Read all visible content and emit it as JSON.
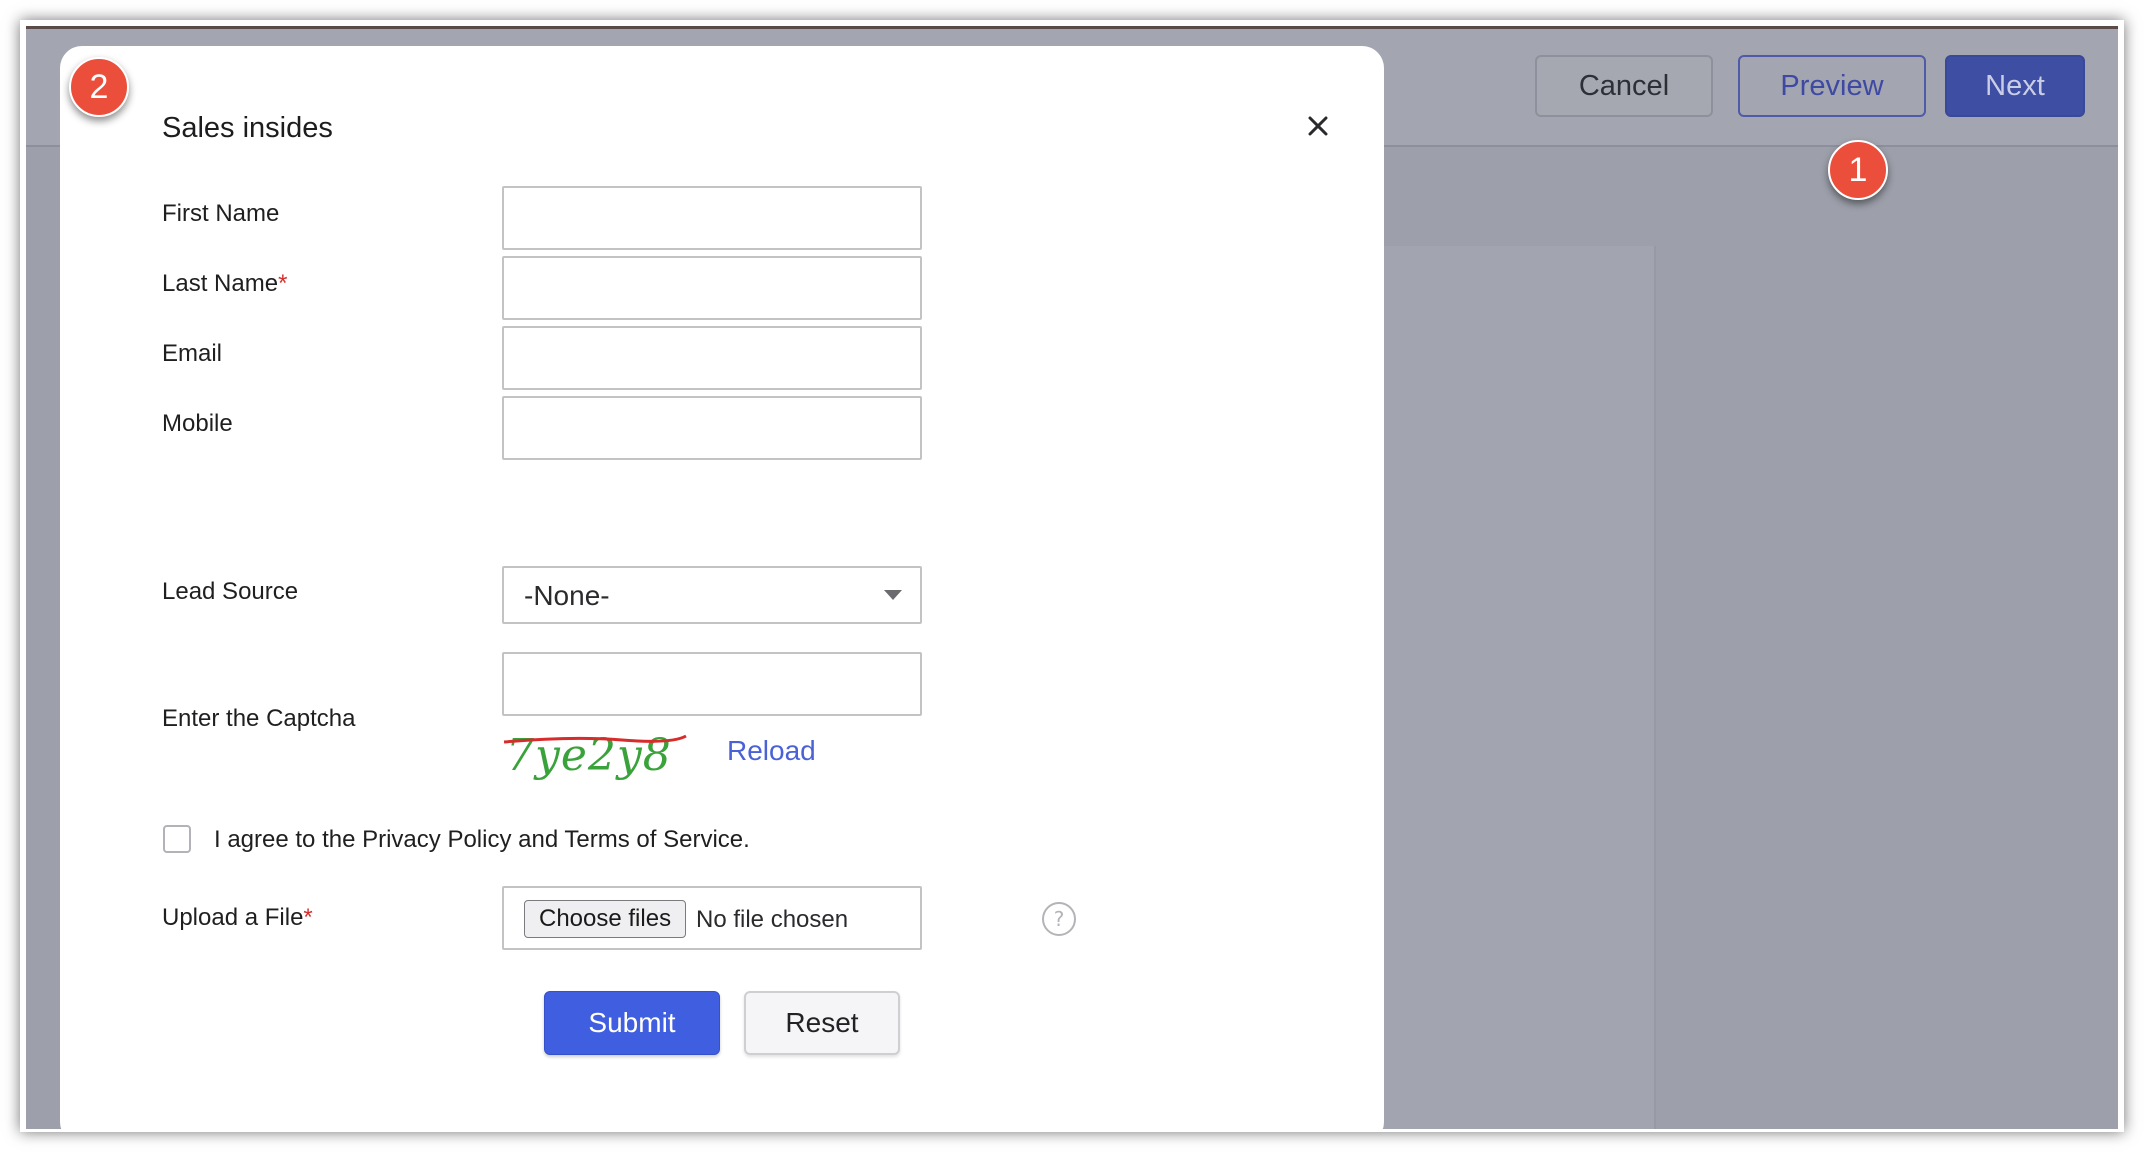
{
  "toolbar": {
    "cancel_label": "Cancel",
    "preview_label": "Preview",
    "next_label": "Next"
  },
  "annotations": {
    "step_1": "1",
    "step_2": "2"
  },
  "modal": {
    "title": "Sales insides",
    "close_icon": "close-icon",
    "fields": {
      "first_name": {
        "label": "First Name",
        "value": ""
      },
      "last_name": {
        "label": "Last Name",
        "required_marker": "*",
        "value": ""
      },
      "email": {
        "label": "Email",
        "value": ""
      },
      "mobile": {
        "label": "Mobile",
        "value": ""
      },
      "lead_source": {
        "label": "Lead Source",
        "selected": "-None-"
      },
      "captcha": {
        "label": "Enter the Captcha",
        "value": "",
        "image_text": "7ye2y8",
        "reload_label": "Reload"
      },
      "agree": {
        "label": "I agree to the Privacy Policy and Terms of Service.",
        "checked": false
      },
      "upload": {
        "label": "Upload a File",
        "required_marker": "*",
        "button_label": "Choose files",
        "status": "No file chosen",
        "help_icon": "question-circle-icon"
      }
    },
    "submit_label": "Submit",
    "reset_label": "Reset"
  },
  "colors": {
    "overlay": "#9da0ab",
    "primary": "#3f5ee0",
    "link": "#4a62d6",
    "required": "#d42f2f",
    "badge": "#ec4e3c",
    "captcha_text": "#3aa23a",
    "captcha_strike": "#d62c2c"
  }
}
